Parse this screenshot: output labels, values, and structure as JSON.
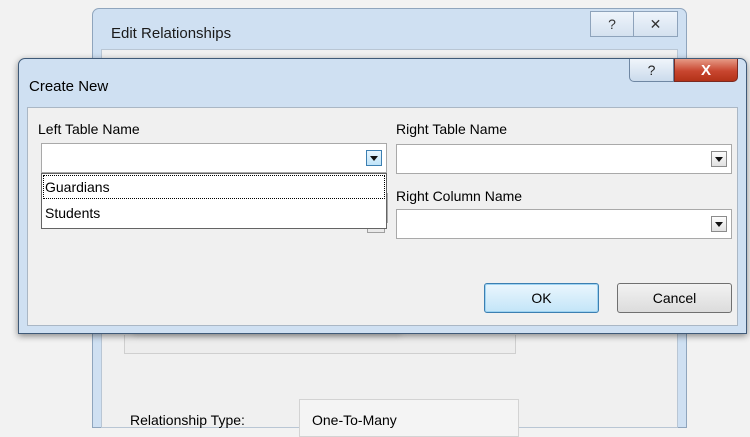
{
  "background_dialog": {
    "title": "Edit Relationships",
    "help_glyph": "?",
    "close_glyph": "✕",
    "relationship_type_label": "Relationship Type:",
    "relationship_type_value": "One-To-Many"
  },
  "create_new_dialog": {
    "title": "Create New",
    "help_glyph": "?",
    "close_glyph": "X",
    "left_table_label": "Left Table Name",
    "left_table_value": "",
    "right_table_label": "Right Table Name",
    "right_table_value": "",
    "right_column_label": "Right Column Name",
    "right_column_value": "",
    "left_table_options": [
      "Guardians",
      "Students"
    ],
    "ok_label": "OK",
    "cancel_label": "Cancel"
  },
  "colors": {
    "frame_blue": "#cfe0f2",
    "close_red": "#c8462f",
    "default_button_blue": "#3c7fb1"
  }
}
